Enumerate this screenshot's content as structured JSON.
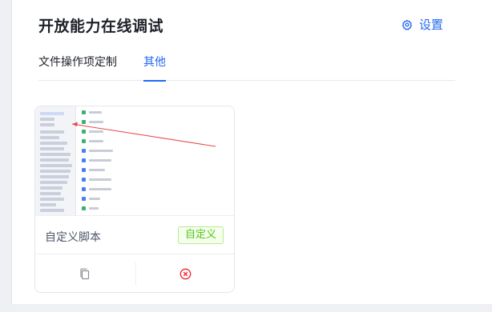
{
  "header": {
    "title": "开放能力在线调试",
    "settings_label": "设置",
    "settings_icon": "gear-icon"
  },
  "tabs": [
    {
      "label": "文件操作项定制",
      "active": false
    },
    {
      "label": "其他",
      "active": true
    }
  ],
  "card": {
    "name": "自定义脚本",
    "badge": "自定义",
    "actions": [
      {
        "icon": "copy-icon"
      },
      {
        "icon": "delete-circle-icon"
      }
    ]
  },
  "colors": {
    "accent": "#2468f2",
    "badge_green": "#52c41a",
    "danger": "#f5222d",
    "annotation_arrow": "#e5484d"
  }
}
